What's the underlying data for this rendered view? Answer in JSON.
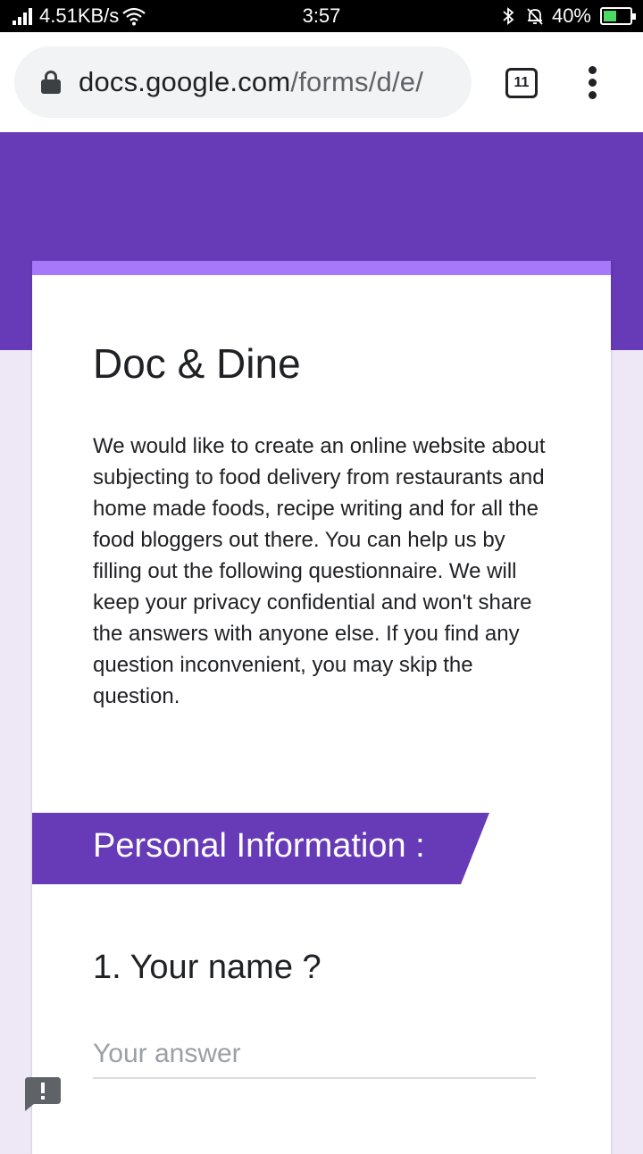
{
  "status_bar": {
    "network_speed": "4.51KB/s",
    "time": "3:57",
    "battery": "40%"
  },
  "browser": {
    "url_domain": "docs.google.com",
    "url_path": "/forms/d/e/",
    "tab_count": "11"
  },
  "colors": {
    "header": "#673ab7",
    "accent": "#a779fa",
    "background": "#ede7f6"
  },
  "form": {
    "title": "Doc & Dine",
    "description": "We would like to create an online website about subjecting to food delivery from restaurants and home made foods, recipe writing and for all the food bloggers out there. You can help us by filling out the following questionnaire. We will keep your privacy confidential and won't share the answers with anyone else. If you find any question inconvenient, you may skip the question.",
    "section_title": "Personal Information :",
    "questions": [
      {
        "label": "1. Your name ?",
        "value": "",
        "placeholder": "Your answer"
      }
    ]
  },
  "icons": [
    "signal-icon",
    "wifi-icon",
    "bluetooth-icon",
    "mute-icon",
    "battery-icon",
    "lock-icon",
    "more-vert-icon",
    "report-issue-icon"
  ]
}
